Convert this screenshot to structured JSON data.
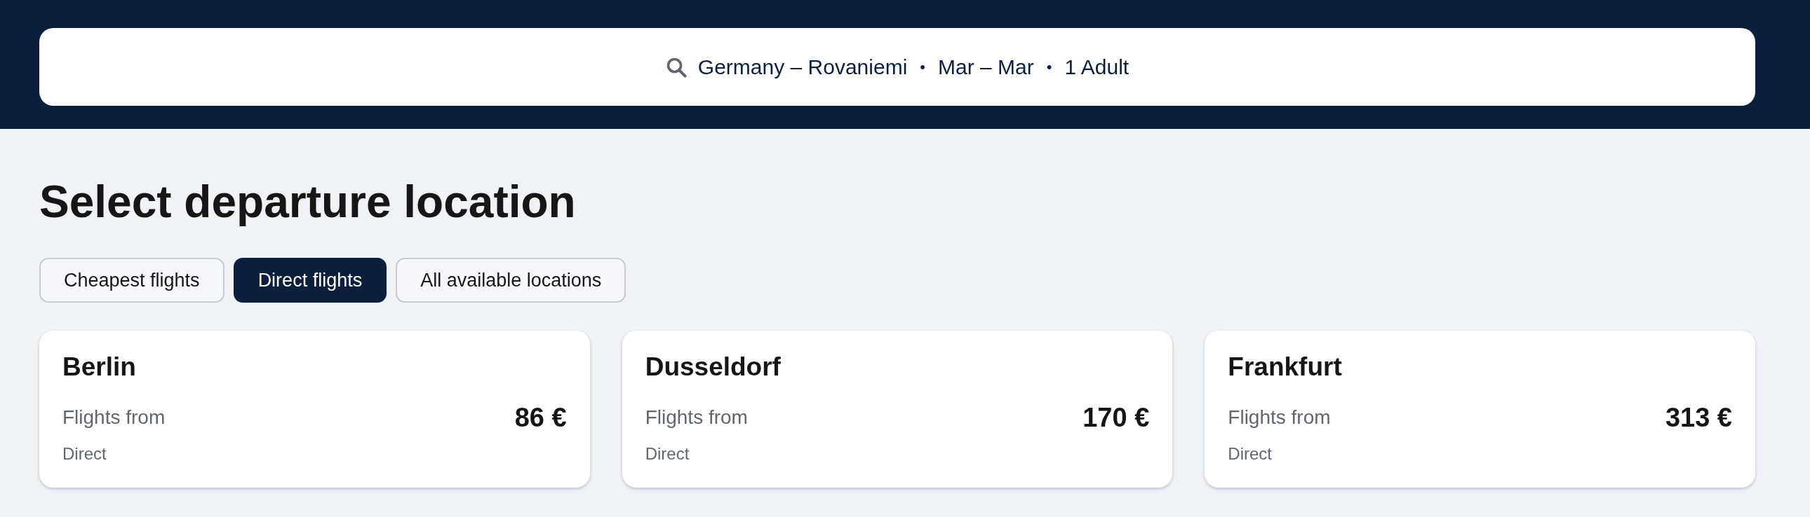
{
  "search": {
    "summary": [
      {
        "kind": "text",
        "text": "Germany – Rovaniemi"
      },
      {
        "kind": "separator",
        "text": "•"
      },
      {
        "kind": "text",
        "text": "Mar – Mar"
      },
      {
        "kind": "separator",
        "text": "•"
      },
      {
        "kind": "text",
        "text": "1 Adult"
      }
    ]
  },
  "title": "Select departure location",
  "filters": [
    {
      "label": "Cheapest flights",
      "selected": false
    },
    {
      "label": "Direct flights",
      "selected": true
    },
    {
      "label": "All available locations",
      "selected": false
    }
  ],
  "cards": [
    {
      "city": "Berlin",
      "caption": "Flights from",
      "price": "86 €",
      "note": "Direct"
    },
    {
      "city": "Dusseldorf",
      "caption": "Flights from",
      "price": "170 €",
      "note": "Direct"
    },
    {
      "city": "Frankfurt",
      "caption": "Flights from",
      "price": "313 €",
      "note": "Direct"
    }
  ]
}
